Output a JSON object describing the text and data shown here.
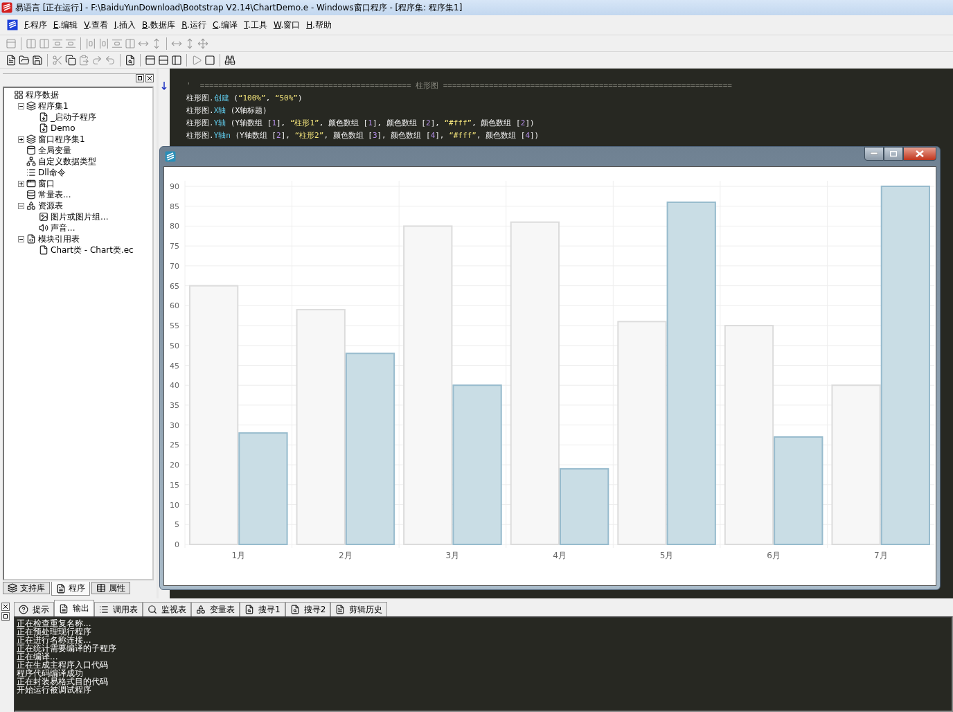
{
  "window": {
    "title": "易语言 [正在运行] - F:\\BaiduYunDownload\\Bootstrap V2.14\\ChartDemo.e - Windows窗口程序 - [程序集: 程序集1]"
  },
  "menu": [
    {
      "key": "F",
      "label": ".程序"
    },
    {
      "key": "E",
      "label": ".编辑"
    },
    {
      "key": "V",
      "label": ".查看"
    },
    {
      "key": "I",
      "label": ".插入"
    },
    {
      "key": "B",
      "label": ".数据库"
    },
    {
      "key": "R",
      "label": ".运行"
    },
    {
      "key": "C",
      "label": ".编译"
    },
    {
      "key": "T",
      "label": ".工具"
    },
    {
      "key": "W",
      "label": ".窗口"
    },
    {
      "key": "H",
      "label": ".帮助"
    }
  ],
  "tree": [
    {
      "label": "程序数据",
      "kind": "root",
      "children": [
        {
          "label": "程序集1",
          "kind": "set",
          "expanded": true,
          "children": [
            {
              "label": "_启动子程序",
              "kind": "sub"
            },
            {
              "label": "Demo",
              "kind": "sub"
            }
          ]
        },
        {
          "label": "窗口程序集1",
          "kind": "set",
          "expanded": false
        },
        {
          "label": "全局变量",
          "kind": "var"
        },
        {
          "label": "自定义数据类型",
          "kind": "type"
        },
        {
          "label": "Dll命令",
          "kind": "dll"
        },
        {
          "label": "窗口",
          "kind": "window",
          "expanded": false
        },
        {
          "label": "常量表...",
          "kind": "const"
        },
        {
          "label": "资源表",
          "kind": "resource",
          "expanded": true,
          "children": [
            {
              "label": "图片或图片组...",
              "kind": "image"
            },
            {
              "label": "声音...",
              "kind": "sound"
            }
          ]
        },
        {
          "label": "模块引用表",
          "kind": "module",
          "expanded": true,
          "children": [
            {
              "label": "Chart类 - Chart类.ec",
              "kind": "file"
            }
          ]
        }
      ]
    }
  ],
  "left_tabs": [
    {
      "label": "支持库",
      "selected": false
    },
    {
      "label": "程序",
      "selected": true
    },
    {
      "label": "属性",
      "selected": false
    }
  ],
  "code": [
    [
      {
        "kind": "comment",
        "text": "'  ============================================== 柱形图 ==============================================================="
      }
    ],
    [
      {
        "kind": "plain",
        "text": "柱形图."
      },
      {
        "kind": "method",
        "text": "创建"
      },
      {
        "kind": "plain",
        "text": " ("
      },
      {
        "kind": "string",
        "text": "“100%”"
      },
      {
        "kind": "plain",
        "text": ", "
      },
      {
        "kind": "string",
        "text": "“50%”"
      },
      {
        "kind": "plain",
        "text": ")"
      }
    ],
    [
      {
        "kind": "plain",
        "text": "柱形图."
      },
      {
        "kind": "method",
        "text": "X轴"
      },
      {
        "kind": "plain",
        "text": " (X轴标题)"
      }
    ],
    [
      {
        "kind": "plain",
        "text": "柱形图."
      },
      {
        "kind": "method",
        "text": "Y轴"
      },
      {
        "kind": "plain",
        "text": " (Y轴数组 ["
      },
      {
        "kind": "number",
        "text": "1"
      },
      {
        "kind": "plain",
        "text": "], "
      },
      {
        "kind": "string",
        "text": "“柱形1”"
      },
      {
        "kind": "plain",
        "text": ", 颜色数组 ["
      },
      {
        "kind": "number",
        "text": "1"
      },
      {
        "kind": "plain",
        "text": "], 颜色数组 ["
      },
      {
        "kind": "number",
        "text": "2"
      },
      {
        "kind": "plain",
        "text": "], "
      },
      {
        "kind": "string",
        "text": "“#fff”"
      },
      {
        "kind": "plain",
        "text": ", 颜色数组 ["
      },
      {
        "kind": "number",
        "text": "2"
      },
      {
        "kind": "plain",
        "text": "])"
      }
    ],
    [
      {
        "kind": "plain",
        "text": "柱形图."
      },
      {
        "kind": "method",
        "text": "Y轴n"
      },
      {
        "kind": "plain",
        "text": " (Y轴数组 ["
      },
      {
        "kind": "number",
        "text": "2"
      },
      {
        "kind": "plain",
        "text": "], "
      },
      {
        "kind": "string",
        "text": "“柱形2”"
      },
      {
        "kind": "plain",
        "text": ", 颜色数组 ["
      },
      {
        "kind": "number",
        "text": "3"
      },
      {
        "kind": "plain",
        "text": "], 颜色数组 ["
      },
      {
        "kind": "number",
        "text": "4"
      },
      {
        "kind": "plain",
        "text": "], "
      },
      {
        "kind": "string",
        "text": "“#fff”"
      },
      {
        "kind": "plain",
        "text": ", 颜色数组 ["
      },
      {
        "kind": "number",
        "text": "4"
      },
      {
        "kind": "plain",
        "text": "])"
      }
    ]
  ],
  "chart_window": {
    "chart_data": {
      "type": "bar",
      "categories": [
        "1月",
        "2月",
        "3月",
        "4月",
        "5月",
        "6月",
        "7月"
      ],
      "series": [
        {
          "color": "#f7f7f7",
          "values": [
            65,
            59,
            80,
            81,
            56,
            55,
            40
          ]
        },
        {
          "color": "#c9dde5",
          "values": [
            28,
            48,
            40,
            19,
            86,
            27,
            90
          ]
        }
      ],
      "grid": true,
      "ylim": [
        0,
        90
      ],
      "yticks": [
        0,
        5,
        10,
        15,
        20,
        25,
        30,
        35,
        40,
        45,
        50,
        55,
        60,
        65,
        70,
        75,
        80,
        85,
        90
      ]
    }
  },
  "bottom_tabs": [
    {
      "label": "提示",
      "selected": false
    },
    {
      "label": "输出",
      "selected": true
    },
    {
      "label": "调用表",
      "selected": false
    },
    {
      "label": "监视表",
      "selected": false
    },
    {
      "label": "变量表",
      "selected": false
    },
    {
      "label": "搜寻1",
      "selected": false
    },
    {
      "label": "搜寻2",
      "selected": false
    },
    {
      "label": "剪辑历史",
      "selected": false
    }
  ],
  "output": [
    "正在检查重复名称...",
    "正在预处理现行程序",
    "正在进行名称连接...",
    "正在统计需要编译的子程序",
    "正在编译...",
    "正在生成主程序入口代码",
    "程序代码编译成功",
    "正在封装易格式目的代码",
    "开始运行被调试程序"
  ]
}
